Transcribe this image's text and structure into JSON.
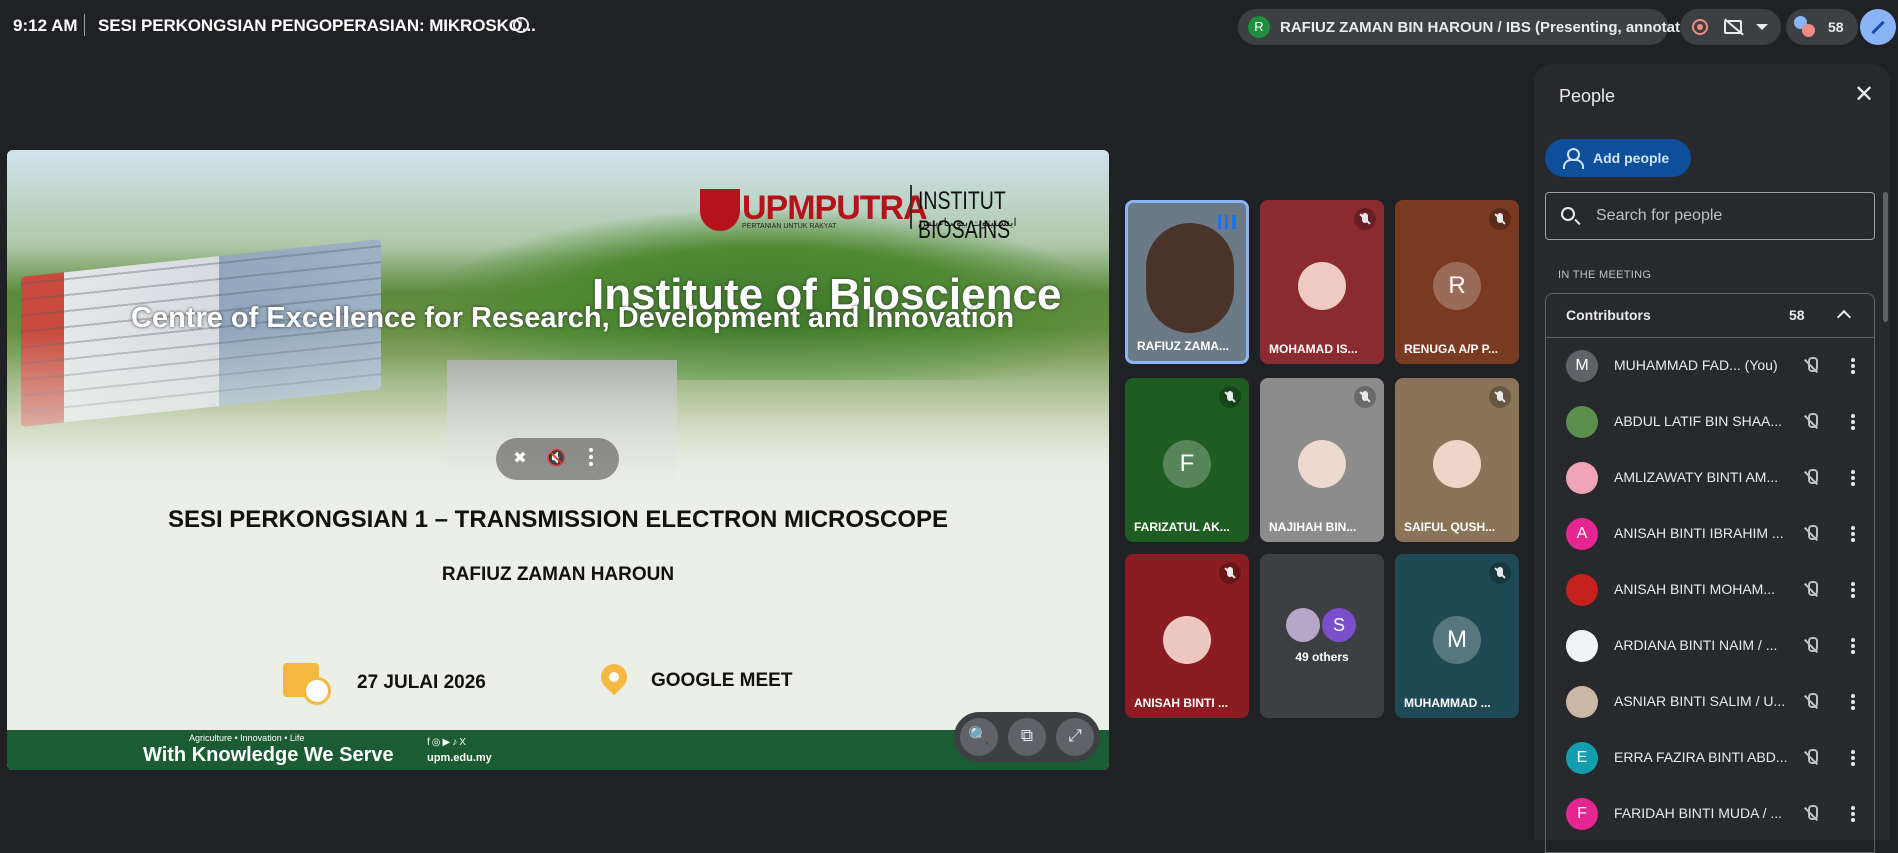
{
  "topbar": {
    "time": "9:12 AM",
    "meeting_title": "SESI PERKONGSIAN PENGOPERASIAN: MIKROSKO...",
    "presenter_initial": "R",
    "presenter_label": "RAFIUZ ZAMAN BIN HAROUN / IBS (Presenting, annotating)",
    "participant_count": "58"
  },
  "slide": {
    "logo_text": "UPMPUTRA",
    "logo_sub": "PERTANIAN UNTUK RAKYAT",
    "logo_institute": "INSTITUT BIOSAINS",
    "logo_arabic": "اينستيتوت بيوساءينس",
    "heading": "Institute of Bioscience",
    "subheading": "Centre of Excellence for Research, Development and Innovation",
    "session_title": "SESI PERKONGSIAN 1 – TRANSMISSION ELECTRON MICROSCOPE",
    "speaker": "RAFIUZ ZAMAN HAROUN",
    "date": "27 JULAI 2026",
    "venue": "GOOGLE MEET",
    "footer_tagline": "Agriculture • Innovation • Life",
    "footer_slogan": "With Knowledge We Serve",
    "footer_social": "f◎▶♪X",
    "footer_url": "upm.edu.my"
  },
  "tiles": [
    {
      "label": "RAFIUZ ZAMA...",
      "initial": "",
      "bg": "#6b7a86",
      "state": "speaking"
    },
    {
      "label": "MOHAMAD IS...",
      "initial": "",
      "bg": "#8b2a2f",
      "state": "muted"
    },
    {
      "label": "RENUGA A/P P...",
      "initial": "R",
      "bg": "#7a3a22",
      "state": "muted"
    },
    {
      "label": "FARIZATUL AK...",
      "initial": "F",
      "bg": "#1f5c22",
      "state": "muted"
    },
    {
      "label": "NAJIHAH BIN...",
      "initial": "",
      "bg": "#8c8c8c",
      "state": "muted"
    },
    {
      "label": "SAIFUL QUSH...",
      "initial": "",
      "bg": "#8a7357",
      "state": "muted"
    },
    {
      "label": "ANISAH BINTI ...",
      "initial": "",
      "bg": "#8b1d22",
      "state": "muted"
    },
    {
      "label": "49 others",
      "initial": "S",
      "bg": "#3c4043",
      "state": "others"
    },
    {
      "label": "MUHAMMAD ...",
      "initial": "M",
      "bg": "#1f4a55",
      "state": "muted"
    }
  ],
  "panel": {
    "title": "People",
    "add_people": "Add people",
    "search_placeholder": "Search for people",
    "section_label": "IN THE MEETING",
    "group_label": "Contributors",
    "group_count": "58",
    "people": [
      {
        "initial": "M",
        "name": "MUHAMMAD FAD...  (You)",
        "color": "#5f6368"
      },
      {
        "initial": "",
        "name": "ABDUL LATIF BIN SHAA...",
        "color": "#5a8f4e"
      },
      {
        "initial": "",
        "name": "AMLIZAWATY BINTI AM...",
        "color": "#f0a4b8"
      },
      {
        "initial": "A",
        "name": "ANISAH BINTI IBRAHIM ...",
        "color": "#e52592"
      },
      {
        "initial": "",
        "name": "ANISAH BINTI MOHAM...",
        "color": "#c5221f"
      },
      {
        "initial": "",
        "name": "ARDIANA BINTI NAIM / ...",
        "color": "#f1f3f4"
      },
      {
        "initial": "",
        "name": "ASNIAR BINTI SALIM / U...",
        "color": "#c9b8a6"
      },
      {
        "initial": "E",
        "name": "ERRA FAZIRA BINTI ABD...",
        "color": "#129eaf"
      },
      {
        "initial": "F",
        "name": "FARIDAH BINTI MUDA / ...",
        "color": "#e52592"
      }
    ]
  }
}
